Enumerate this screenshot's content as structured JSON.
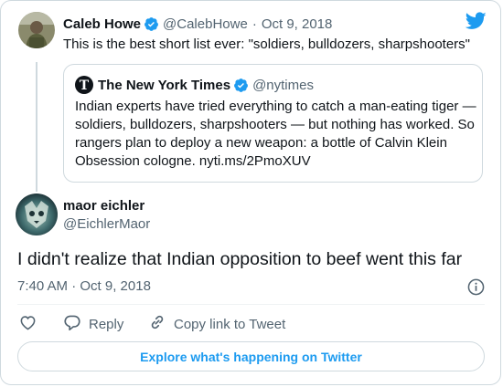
{
  "retweeted": {
    "author_name": "Caleb Howe",
    "author_handle": "@CalebHowe",
    "separator": "·",
    "date": "Oct 9, 2018",
    "text": "This is the best short list ever: \"soldiers, bulldozers, sharpshooters\"",
    "quoted": {
      "author_name": "The New York Times",
      "author_handle": "@nytimes",
      "text": "Indian experts have tried everything to catch a man-eating tiger — soldiers, bulldozers, sharpshooters — but nothing has worked. So rangers plan to deploy a new weapon: a bottle of Calvin Klein Obsession cologne. nyti.ms/2PmoXUV"
    }
  },
  "tweet": {
    "author_name": "maor eichler",
    "author_handle": "@EichlerMaor",
    "text": "I didn't realize that Indian opposition to beef went this far",
    "timestamp": "7:40 AM · Oct 9, 2018"
  },
  "actions": {
    "reply_label": "Reply",
    "copy_label": "Copy link to Tweet"
  },
  "explore_label": "Explore what's happening on Twitter",
  "colors": {
    "accent": "#1d9bf0",
    "muted": "#536471",
    "border": "#cfd9de"
  },
  "icons": [
    "twitter-bird-icon",
    "verified-badge-icon",
    "nyt-logo-icon",
    "info-icon",
    "heart-icon",
    "reply-icon",
    "link-icon"
  ]
}
